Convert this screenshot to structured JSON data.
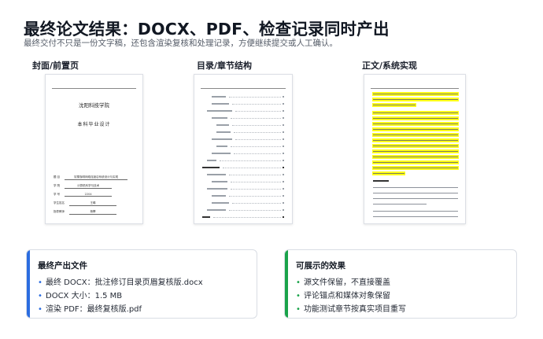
{
  "header": {
    "title": "最终论文结果：DOCX、PDF、检查记录同时产出",
    "subtitle": "最终交付不只是一份文字稿，还包含渲染复核和处理记录，方便继续提交或人工确认。"
  },
  "columns": {
    "cover_label": "封面/前置页",
    "toc_label": "目录/章节结构",
    "body_label": "正文/系统实现"
  },
  "cover_page": {
    "school": "沈阳科技学院",
    "subtitle": "本科毕业设计",
    "fields": [
      {
        "label": "题    目",
        "value": "钦栗咖啡网络连锁店系统设计与实现"
      },
      {
        "label": "学    院",
        "value": "计算机科学与技术"
      },
      {
        "label": "学    号",
        "value": "2204"
      },
      {
        "label": "学生姓名",
        "value": "王晞"
      },
      {
        "label": "指导教师",
        "value": "杨攀"
      }
    ]
  },
  "outputs_card": {
    "title": "最终产出文件",
    "items": [
      "最终 DOCX：批注修订目录页眉复核版.docx",
      "DOCX 大小：1.5 MB",
      "渲染 PDF：最终复核版.pdf"
    ]
  },
  "effects_card": {
    "title": "可展示的效果",
    "items": [
      "源文件保留，不直接覆盖",
      "评论锚点和媒体对象保留",
      "功能测试章节按真实项目重写"
    ]
  },
  "colors": {
    "accent_blue": "#2b6de0",
    "accent_green": "#1aa34a",
    "highlight": "#ffff1a"
  }
}
